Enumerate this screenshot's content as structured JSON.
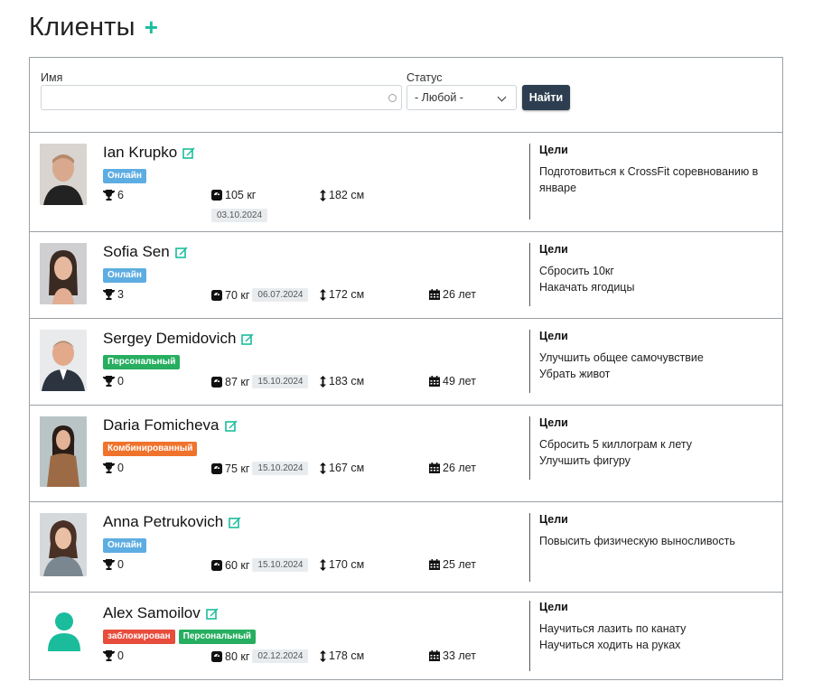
{
  "page": {
    "title": "Клиенты",
    "add_button": "+"
  },
  "filters": {
    "name_label": "Имя",
    "name_value": "",
    "status_label": "Статус",
    "status_value": "- Любой -",
    "search_button": "Найти"
  },
  "colors": {
    "accent": "#1abc9c",
    "badge_online": "#5dade2",
    "badge_personal": "#27ae60",
    "badge_combined": "#f0732c",
    "badge_blocked": "#e74c3c",
    "button_dark": "#2c3e50"
  },
  "goals_title": "Цели",
  "clients": [
    {
      "name": "Ian Krupko",
      "badges": [
        {
          "label": "Онлайн",
          "type": "online"
        }
      ],
      "trophies": "6",
      "weight": "105 кг",
      "weight_date": "03.10.2024",
      "height": "182 см",
      "age": "",
      "goals": [
        "Подготовиться к CrossFit соревнованию в январе"
      ],
      "avatar": "photo-man-bald"
    },
    {
      "name": "Sofia Sen",
      "badges": [
        {
          "label": "Онлайн",
          "type": "online"
        }
      ],
      "trophies": "3",
      "weight": "70 кг",
      "weight_date": "06.07.2024",
      "height": "172 см",
      "age": "26 лет",
      "goals": [
        "Сбросить 10кг",
        "Накачать ягодицы"
      ],
      "avatar": "photo-woman-dark-hair"
    },
    {
      "name": "Sergey Demidovich",
      "badges": [
        {
          "label": "Персональный",
          "type": "personal"
        }
      ],
      "trophies": "0",
      "weight": "87 кг",
      "weight_date": "15.10.2024",
      "height": "183 см",
      "age": "49 лет",
      "goals": [
        "Улучшить общее самочувствие",
        "Убрать живот"
      ],
      "avatar": "photo-man-suit"
    },
    {
      "name": "Daria Fomicheva",
      "badges": [
        {
          "label": "Комбинированный",
          "type": "combined"
        }
      ],
      "trophies": "0",
      "weight": "75 кг",
      "weight_date": "15.10.2024",
      "height": "167 см",
      "age": "26 лет",
      "goals": [
        "Сбросить 5 киллограм к лету",
        "Улучшить фигуру"
      ],
      "avatar": "photo-woman-coat"
    },
    {
      "name": "Anna Petrukovich",
      "badges": [
        {
          "label": "Онлайн",
          "type": "online"
        }
      ],
      "trophies": "0",
      "weight": "60 кг",
      "weight_date": "15.10.2024",
      "height": "170 см",
      "age": "25 лет",
      "goals": [
        "Повысить физическую выносливость"
      ],
      "avatar": "photo-woman-outdoor"
    },
    {
      "name": "Alex Samoilov",
      "badges": [
        {
          "label": "заблокирован",
          "type": "blocked"
        },
        {
          "label": "Персональный",
          "type": "personal"
        }
      ],
      "trophies": "0",
      "weight": "80 кг",
      "weight_date": "02.12.2024",
      "height": "178 см",
      "age": "33 лет",
      "goals": [
        "Научиться лазить по канату",
        "Научиться ходить на руках"
      ],
      "avatar": "user-placeholder-icon"
    }
  ]
}
